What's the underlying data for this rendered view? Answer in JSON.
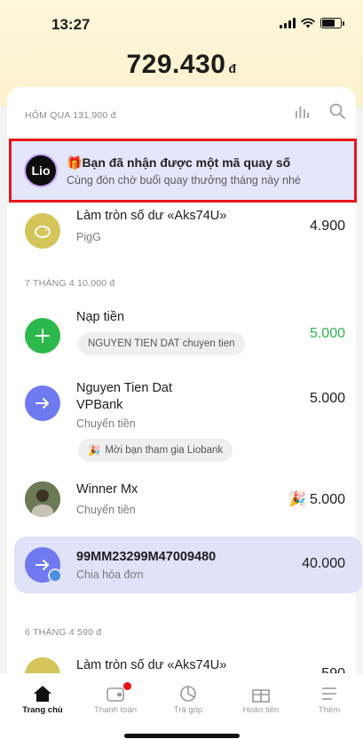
{
  "status": {
    "time": "13:27"
  },
  "balance": {
    "amount": "729.430",
    "currency": "đ"
  },
  "groups": {
    "yesterday": "HÔM QUA 131.900 đ",
    "apr7": "7 THÁNG 4 10.000 đ",
    "apr6": "6 THÁNG 4 590 đ"
  },
  "notice": {
    "logo": "Lio",
    "gift_emoji": "🎁",
    "title": "Bạn đã nhận được một mã quay số",
    "subtitle": "Cùng đón chờ buổi quay thưởng tháng này nhé"
  },
  "transactions": [
    {
      "name": "Làm tròn số dư «Aks74U»",
      "sub": "PigG",
      "amount": "4.900",
      "icon": "piggy-icon"
    },
    {
      "name": "Nạp tiền",
      "chip": "NGUYEN TIEN DAT chuyen tien",
      "amount": "5.000",
      "amount_color": "#2cb84a",
      "icon": "plus-icon"
    },
    {
      "name": "Nguyen Tien Dat",
      "name2": "VPBank",
      "sub": "Chuyển tiền",
      "chip": "Mời bạn tham gia Liobank",
      "amount": "5.000",
      "icon": "arrow-right-icon"
    },
    {
      "name": "Winner Mx",
      "sub": "Chuyển tiền",
      "amount": "5.000",
      "icon": "avatar"
    },
    {
      "name": "99MM23299M47009480",
      "sub": "Chia hóa đơn",
      "amount": "40.000",
      "icon": "arrow-right-icon"
    },
    {
      "name": "Làm tròn số dư «Aks74U»",
      "amount": "590",
      "icon": "piggy-icon"
    }
  ],
  "tabs": [
    {
      "label": "Trang chủ",
      "icon": "home-icon"
    },
    {
      "label": "Thanh toán",
      "icon": "wallet-icon"
    },
    {
      "label": "Trả góp",
      "icon": "pie-chart-icon"
    },
    {
      "label": "Hoàn tiền",
      "icon": "gift-icon"
    },
    {
      "label": "Thêm",
      "icon": "menu-icon"
    }
  ],
  "colors": {
    "accent": "#6f79f0",
    "green": "#2cb84a",
    "gold": "#d4c55a",
    "alert_border": "#e8141c"
  }
}
